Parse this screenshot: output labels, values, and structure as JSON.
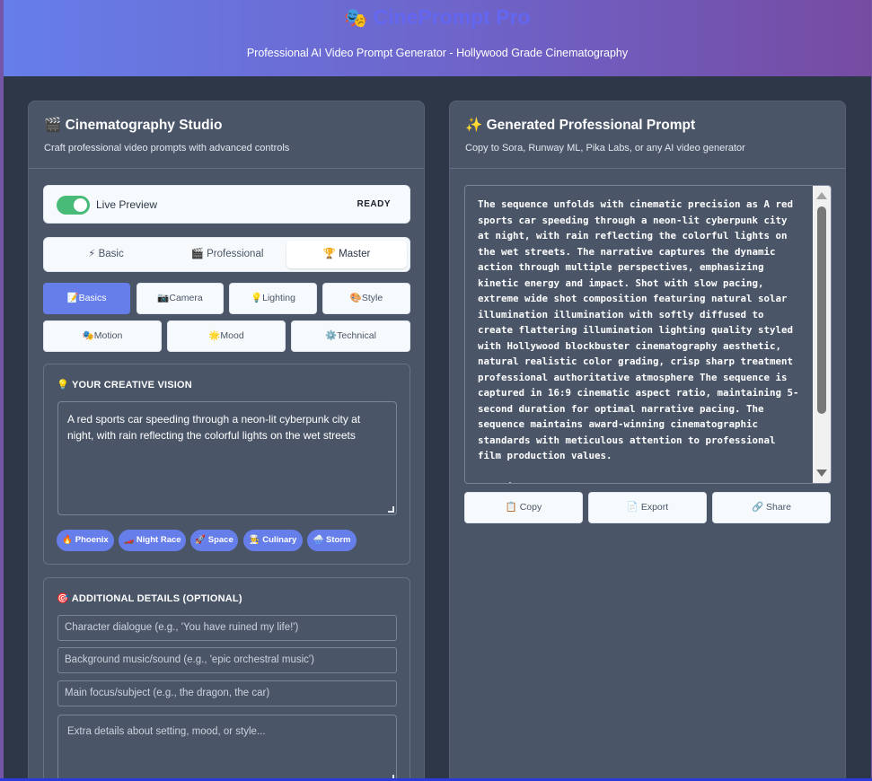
{
  "header": {
    "logo_icon": "🎭",
    "title": "CinePrompt Pro",
    "subtitle": "Professional AI Video Prompt Generator - Hollywood Grade Cinematography"
  },
  "studio": {
    "title": "🎬 Cinematography Studio",
    "subtitle": "Craft professional video prompts with advanced controls",
    "live_preview": {
      "label": "Live Preview",
      "status": "READY",
      "enabled": true
    },
    "levels": [
      {
        "label": "⚡ Basic"
      },
      {
        "label": "🎬 Professional"
      },
      {
        "label": "🏆 Master"
      }
    ],
    "active_level": "Master",
    "tabs_row1": [
      {
        "label": "📝Basics"
      },
      {
        "label": "📷Camera"
      },
      {
        "label": "💡Lighting"
      },
      {
        "label": "🎨Style"
      }
    ],
    "tabs_row2": [
      {
        "label": "🎭Motion"
      },
      {
        "label": "🌟Mood"
      },
      {
        "label": "⚙️Technical"
      }
    ],
    "vision": {
      "title": "💡 YOUR CREATIVE VISION",
      "value": "A red sports car speeding through a neon-lit cyberpunk city at night, with rain reflecting the colorful lights on the wet streets"
    },
    "chips": [
      {
        "label": "🔥 Phoenix"
      },
      {
        "label": "🏎️ Night Race"
      },
      {
        "label": "🚀 Space"
      },
      {
        "label": "👨‍🍳 Culinary"
      },
      {
        "label": "🌧️ Storm"
      }
    ],
    "details": {
      "title": "🎯 ADDITIONAL DETAILS (OPTIONAL)",
      "dialogue_placeholder": "Character dialogue (e.g., 'You have ruined my life!')",
      "music_placeholder": "Background music/sound (e.g., 'epic orchestral music')",
      "focus_placeholder": "Main focus/subject (e.g., the dragon, the car)",
      "extra_placeholder": "Extra details about setting, mood, or style..."
    }
  },
  "output": {
    "title": "✨ Generated Professional Prompt",
    "subtitle": "Copy to Sora, Runway ML, Pika Labs, or any AI video generator",
    "prompt_text": "The sequence unfolds with cinematic precision as A red sports car speeding through a neon-lit cyberpunk city at night, with rain reflecting the colorful lights on the wet streets. The narrative captures the dynamic action through multiple perspectives, emphasizing kinetic energy and impact. Shot with slow pacing, extreme wide shot composition featuring natural solar illumination illumination with softly diffused to create flattering illumination lighting quality styled with Hollywood blockbuster cinematography aesthetic, natural realistic color grading, crisp sharp treatment professional authoritative atmosphere The sequence is captured in 16:9 cinematic aspect ratio, maintaining 5-second duration for optimal narrative pacing. The sequence maintains award-winning cinematographic standards with meticulous attention to professional film production values.\n\nNegative prompt: watermark, text overlay",
    "actions": [
      {
        "label": "📋 Copy"
      },
      {
        "label": "📄 Export"
      },
      {
        "label": "🔗 Share"
      }
    ]
  },
  "colors": {
    "accent": "#667eea",
    "toggle_on": "#48bb78",
    "panel": "#4a5568",
    "background": "#2d3748"
  }
}
